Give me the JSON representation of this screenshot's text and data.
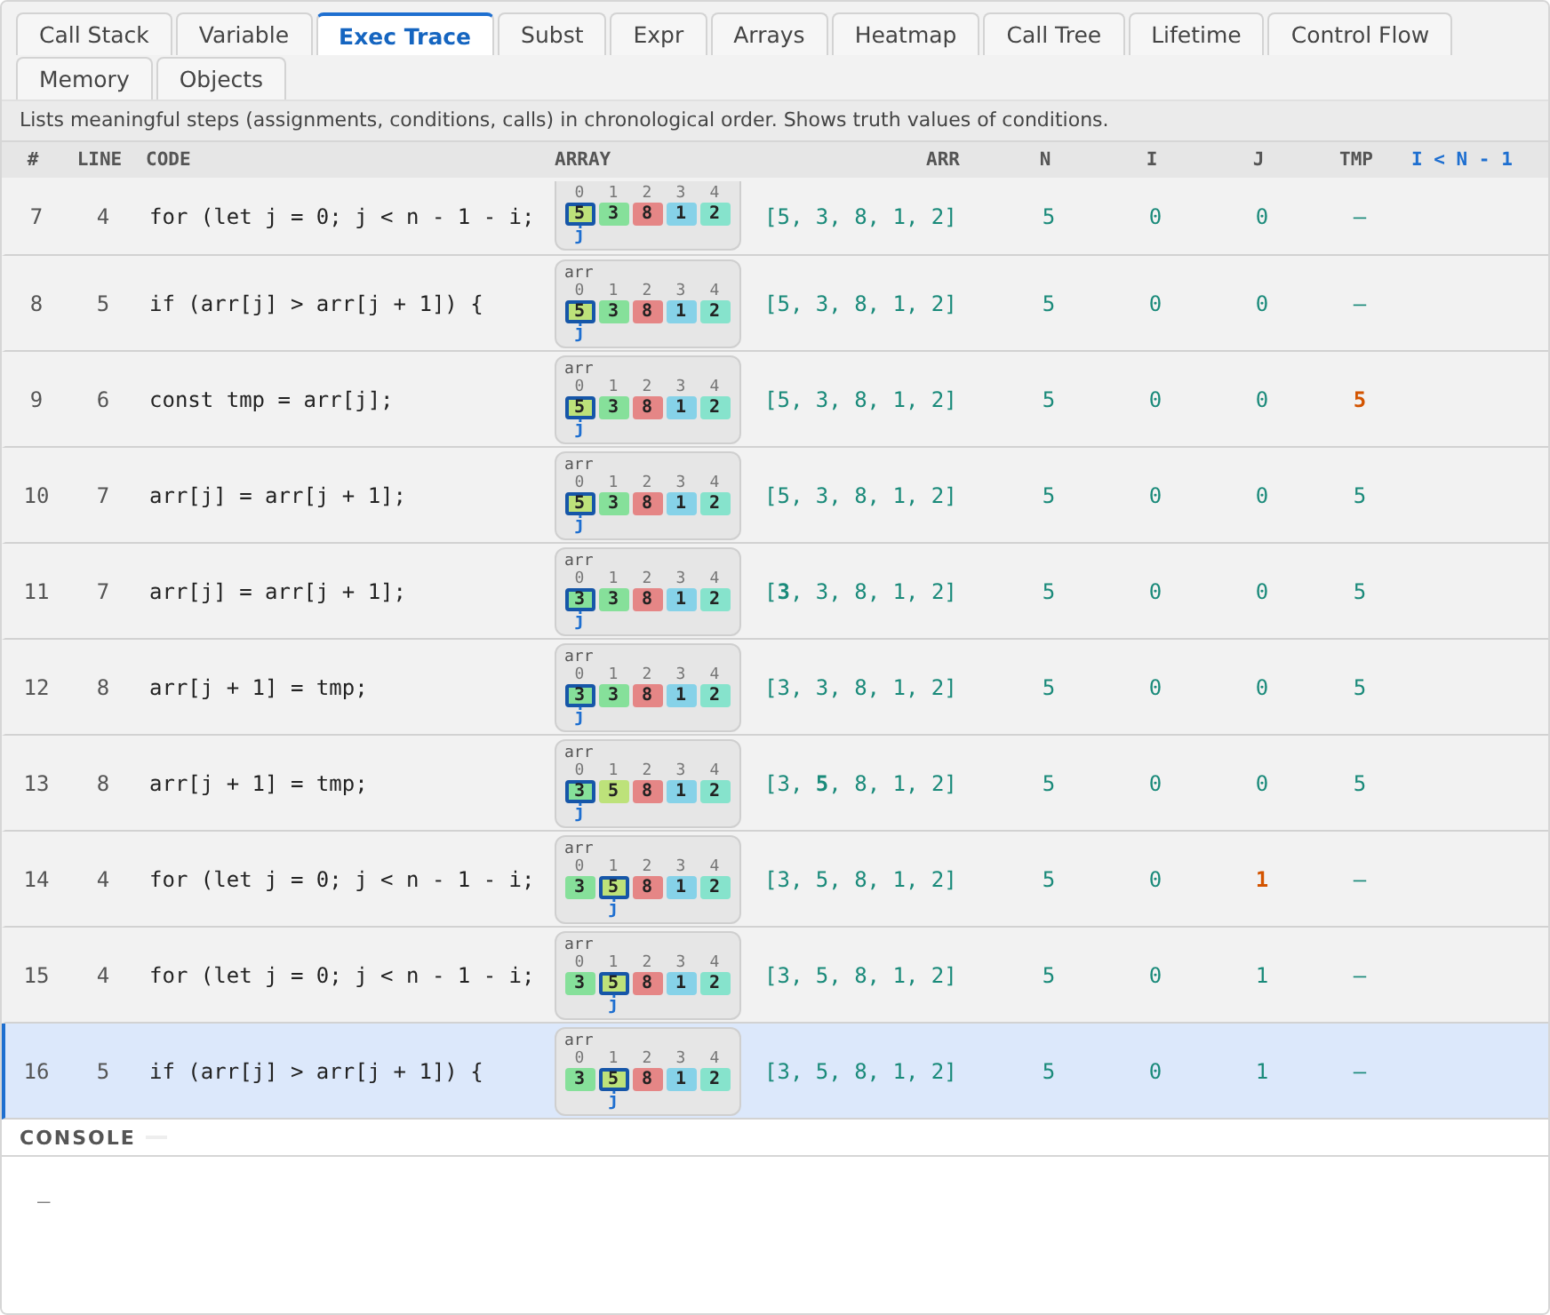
{
  "tabs": [
    {
      "label": "Call Stack",
      "selected": false
    },
    {
      "label": "Variable",
      "selected": false
    },
    {
      "label": "Exec Trace",
      "selected": true
    },
    {
      "label": "Subst",
      "selected": false
    },
    {
      "label": "Expr",
      "selected": false
    },
    {
      "label": "Arrays",
      "selected": false
    },
    {
      "label": "Heatmap",
      "selected": false
    },
    {
      "label": "Call Tree",
      "selected": false
    },
    {
      "label": "Lifetime",
      "selected": false
    },
    {
      "label": "Control Flow",
      "selected": false
    },
    {
      "label": "Memory",
      "selected": false
    },
    {
      "label": "Objects",
      "selected": false
    }
  ],
  "description": "Lists meaningful steps (assignments, conditions, calls) in chronological order. Shows truth values of conditions.",
  "table": {
    "columns": [
      {
        "label": "#",
        "kind": "num"
      },
      {
        "label": "LINE",
        "kind": "num"
      },
      {
        "label": "CODE",
        "kind": "text"
      },
      {
        "label": "ARRAY",
        "kind": "text"
      },
      {
        "label": "ARR",
        "kind": "right"
      },
      {
        "label": "N",
        "kind": "center"
      },
      {
        "label": "I",
        "kind": "center"
      },
      {
        "label": "J",
        "kind": "center"
      },
      {
        "label": "TMP",
        "kind": "center"
      },
      {
        "label": "I < N - 1",
        "kind": "condition"
      }
    ],
    "rows": [
      {
        "step": "7",
        "line": "4",
        "code": "for (let j = 0; j < n - 1 - i;",
        "selected": false,
        "array": {
          "cells": [
            {
              "index": "0",
              "value": "5",
              "color": "#bde27a",
              "selected": true,
              "pointer": "j"
            },
            {
              "index": "1",
              "value": "3",
              "color": "#86e09a",
              "selected": false
            },
            {
              "index": "2",
              "value": "8",
              "color": "#e58686",
              "selected": false
            },
            {
              "index": "3",
              "value": "1",
              "color": "#86d2e8",
              "selected": false
            },
            {
              "index": "4",
              "value": "2",
              "color": "#86e3cc",
              "selected": false
            }
          ]
        },
        "arr": "[5, 3, 8, 1, 2]",
        "n": {
          "text": "5",
          "changed": false
        },
        "i": {
          "text": "0",
          "changed": false
        },
        "j": {
          "text": "0",
          "changed": false
        },
        "tmp": {
          "text": "—",
          "changed": false
        }
      },
      {
        "step": "8",
        "line": "5",
        "code": "if (arr[j] > arr[j + 1]) {",
        "selected": false,
        "array": {
          "label": "arr",
          "cells": [
            {
              "index": "0",
              "value": "5",
              "color": "#bde27a",
              "selected": true,
              "pointer": "j"
            },
            {
              "index": "1",
              "value": "3",
              "color": "#86e09a",
              "selected": false
            },
            {
              "index": "2",
              "value": "8",
              "color": "#e58686",
              "selected": false
            },
            {
              "index": "3",
              "value": "1",
              "color": "#86d2e8",
              "selected": false
            },
            {
              "index": "4",
              "value": "2",
              "color": "#86e3cc",
              "selected": false
            }
          ]
        },
        "arr": "[5, 3, 8, 1, 2]",
        "n": {
          "text": "5",
          "changed": false
        },
        "i": {
          "text": "0",
          "changed": false
        },
        "j": {
          "text": "0",
          "changed": false
        },
        "tmp": {
          "text": "—",
          "changed": false
        }
      },
      {
        "step": "9",
        "line": "6",
        "code": "const tmp = arr[j];",
        "selected": false,
        "array": {
          "label": "arr",
          "cells": [
            {
              "index": "0",
              "value": "5",
              "color": "#bde27a",
              "selected": true,
              "pointer": "j"
            },
            {
              "index": "1",
              "value": "3",
              "color": "#86e09a",
              "selected": false
            },
            {
              "index": "2",
              "value": "8",
              "color": "#e58686",
              "selected": false
            },
            {
              "index": "3",
              "value": "1",
              "color": "#86d2e8",
              "selected": false
            },
            {
              "index": "4",
              "value": "2",
              "color": "#86e3cc",
              "selected": false
            }
          ]
        },
        "arr": "[5, 3, 8, 1, 2]",
        "n": {
          "text": "5",
          "changed": false
        },
        "i": {
          "text": "0",
          "changed": false
        },
        "j": {
          "text": "0",
          "changed": false
        },
        "tmp": {
          "text": "5",
          "changed": true
        }
      },
      {
        "step": "10",
        "line": "7",
        "code": "arr[j] = arr[j + 1];",
        "selected": false,
        "array": {
          "label": "arr",
          "cells": [
            {
              "index": "0",
              "value": "5",
              "color": "#bde27a",
              "selected": true,
              "pointer": "j"
            },
            {
              "index": "1",
              "value": "3",
              "color": "#86e09a",
              "selected": false
            },
            {
              "index": "2",
              "value": "8",
              "color": "#e58686",
              "selected": false
            },
            {
              "index": "3",
              "value": "1",
              "color": "#86d2e8",
              "selected": false
            },
            {
              "index": "4",
              "value": "2",
              "color": "#86e3cc",
              "selected": false
            }
          ]
        },
        "arr": "[5, 3, 8, 1, 2]",
        "n": {
          "text": "5",
          "changed": false
        },
        "i": {
          "text": "0",
          "changed": false
        },
        "j": {
          "text": "0",
          "changed": false
        },
        "tmp": {
          "text": "5",
          "changed": false
        }
      },
      {
        "step": "11",
        "line": "7",
        "code": "arr[j] = arr[j + 1];",
        "selected": false,
        "array": {
          "label": "arr",
          "cells": [
            {
              "index": "0",
              "value": "3",
              "color": "#86e09a",
              "selected": true,
              "pointer": "j"
            },
            {
              "index": "1",
              "value": "3",
              "color": "#86e09a",
              "selected": false
            },
            {
              "index": "2",
              "value": "8",
              "color": "#e58686",
              "selected": false
            },
            {
              "index": "3",
              "value": "1",
              "color": "#86d2e8",
              "selected": false
            },
            {
              "index": "4",
              "value": "2",
              "color": "#86e3cc",
              "selected": false
            }
          ]
        },
        "arr": "[**3**, 3, 8, 1, 2]",
        "n": {
          "text": "5",
          "changed": false
        },
        "i": {
          "text": "0",
          "changed": false
        },
        "j": {
          "text": "0",
          "changed": false
        },
        "tmp": {
          "text": "5",
          "changed": false
        }
      },
      {
        "step": "12",
        "line": "8",
        "code": "arr[j + 1] = tmp;",
        "selected": false,
        "array": {
          "label": "arr",
          "cells": [
            {
              "index": "0",
              "value": "3",
              "color": "#86e09a",
              "selected": true,
              "pointer": "j"
            },
            {
              "index": "1",
              "value": "3",
              "color": "#86e09a",
              "selected": false
            },
            {
              "index": "2",
              "value": "8",
              "color": "#e58686",
              "selected": false
            },
            {
              "index": "3",
              "value": "1",
              "color": "#86d2e8",
              "selected": false
            },
            {
              "index": "4",
              "value": "2",
              "color": "#86e3cc",
              "selected": false
            }
          ]
        },
        "arr": "[3, 3, 8, 1, 2]",
        "n": {
          "text": "5",
          "changed": false
        },
        "i": {
          "text": "0",
          "changed": false
        },
        "j": {
          "text": "0",
          "changed": false
        },
        "tmp": {
          "text": "5",
          "changed": false
        }
      },
      {
        "step": "13",
        "line": "8",
        "code": "arr[j + 1] = tmp;",
        "selected": false,
        "array": {
          "label": "arr",
          "cells": [
            {
              "index": "0",
              "value": "3",
              "color": "#86e09a",
              "selected": true,
              "pointer": "j"
            },
            {
              "index": "1",
              "value": "5",
              "color": "#bde27a",
              "selected": false
            },
            {
              "index": "2",
              "value": "8",
              "color": "#e58686",
              "selected": false
            },
            {
              "index": "3",
              "value": "1",
              "color": "#86d2e8",
              "selected": false
            },
            {
              "index": "4",
              "value": "2",
              "color": "#86e3cc",
              "selected": false
            }
          ]
        },
        "arr": "[3, **5**, 8, 1, 2]",
        "n": {
          "text": "5",
          "changed": false
        },
        "i": {
          "text": "0",
          "changed": false
        },
        "j": {
          "text": "0",
          "changed": false
        },
        "tmp": {
          "text": "5",
          "changed": false
        }
      },
      {
        "step": "14",
        "line": "4",
        "code": "for (let j = 0; j < n - 1 - i;",
        "selected": false,
        "array": {
          "label": "arr",
          "cells": [
            {
              "index": "0",
              "value": "3",
              "color": "#86e09a",
              "selected": false
            },
            {
              "index": "1",
              "value": "5",
              "color": "#bde27a",
              "selected": true,
              "pointer": "j"
            },
            {
              "index": "2",
              "value": "8",
              "color": "#e58686",
              "selected": false
            },
            {
              "index": "3",
              "value": "1",
              "color": "#86d2e8",
              "selected": false
            },
            {
              "index": "4",
              "value": "2",
              "color": "#86e3cc",
              "selected": false
            }
          ]
        },
        "arr": "[3, 5, 8, 1, 2]",
        "n": {
          "text": "5",
          "changed": false
        },
        "i": {
          "text": "0",
          "changed": false
        },
        "j": {
          "text": "1",
          "changed": true
        },
        "tmp": {
          "text": "—",
          "changed": false
        }
      },
      {
        "step": "15",
        "line": "4",
        "code": "for (let j = 0; j < n - 1 - i;",
        "selected": false,
        "array": {
          "label": "arr",
          "cells": [
            {
              "index": "0",
              "value": "3",
              "color": "#86e09a",
              "selected": false
            },
            {
              "index": "1",
              "value": "5",
              "color": "#bde27a",
              "selected": true,
              "pointer": "j"
            },
            {
              "index": "2",
              "value": "8",
              "color": "#e58686",
              "selected": false
            },
            {
              "index": "3",
              "value": "1",
              "color": "#86d2e8",
              "selected": false
            },
            {
              "index": "4",
              "value": "2",
              "color": "#86e3cc",
              "selected": false
            }
          ]
        },
        "arr": "[3, 5, 8, 1, 2]",
        "n": {
          "text": "5",
          "changed": false
        },
        "i": {
          "text": "0",
          "changed": false
        },
        "j": {
          "text": "1",
          "changed": false
        },
        "tmp": {
          "text": "—",
          "changed": false
        }
      },
      {
        "step": "16",
        "line": "5",
        "code": "if (arr[j] > arr[j + 1]) {",
        "selected": true,
        "array": {
          "label": "arr",
          "cells": [
            {
              "index": "0",
              "value": "3",
              "color": "#86e09a",
              "selected": false
            },
            {
              "index": "1",
              "value": "5",
              "color": "#bde27a",
              "selected": true,
              "pointer": "j"
            },
            {
              "index": "2",
              "value": "8",
              "color": "#e58686",
              "selected": false
            },
            {
              "index": "3",
              "value": "1",
              "color": "#86d2e8",
              "selected": false
            },
            {
              "index": "4",
              "value": "2",
              "color": "#86e3cc",
              "selected": false
            }
          ]
        },
        "arr": "[3, 5, 8, 1, 2]",
        "n": {
          "text": "5",
          "changed": false
        },
        "i": {
          "text": "0",
          "changed": false
        },
        "j": {
          "text": "1",
          "changed": false
        },
        "tmp": {
          "text": "—",
          "changed": false
        }
      }
    ]
  },
  "console": {
    "title": "CONSOLE",
    "output": "_"
  }
}
